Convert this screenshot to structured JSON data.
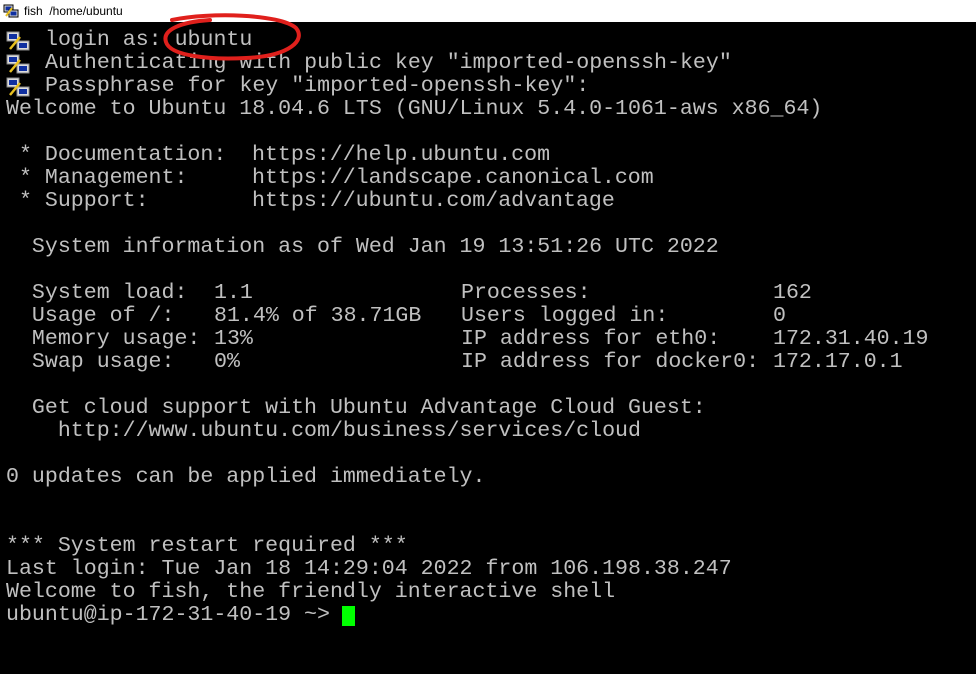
{
  "window": {
    "title": "fish  /home/ubuntu",
    "icon": "putty-icon"
  },
  "session": {
    "login_prefix": "login as: ",
    "username": "ubuntu",
    "auth_line": "Authenticating with public key \"imported-openssh-key\"",
    "passphrase_line": "Passphrase for key \"imported-openssh-key\":",
    "welcome": "Welcome to Ubuntu 18.04.6 LTS (GNU/Linux 5.4.0-1061-aws x86_64)"
  },
  "links": [
    {
      "label": " * Documentation:",
      "url": "https://help.ubuntu.com"
    },
    {
      "label": " * Management:",
      "url": "https://landscape.canonical.com"
    },
    {
      "label": " * Support:",
      "url": "https://ubuntu.com/advantage"
    }
  ],
  "sysinfo_header": "  System information as of Wed Jan 19 13:51:26 UTC 2022",
  "sysinfo": {
    "left": [
      {
        "label": "  System load:",
        "value": "1.1"
      },
      {
        "label": "  Usage of /:",
        "value": "81.4% of 38.71GB"
      },
      {
        "label": "  Memory usage:",
        "value": "13%"
      },
      {
        "label": "  Swap usage:",
        "value": "0%"
      }
    ],
    "right": [
      {
        "label": "Processes:",
        "value": "162"
      },
      {
        "label": "Users logged in:",
        "value": "0"
      },
      {
        "label": "IP address for eth0:",
        "value": "172.31.40.19"
      },
      {
        "label": "IP address for docker0:",
        "value": "172.17.0.1"
      }
    ]
  },
  "cloud": {
    "line1": "  Get cloud support with Ubuntu Advantage Cloud Guest:",
    "line2": "    http://www.ubuntu.com/business/services/cloud"
  },
  "updates_line": "0 updates can be applied immediately.",
  "restart_line": "*** System restart required ***",
  "last_login": "Last login: Tue Jan 18 14:29:04 2022 from 106.198.38.247",
  "fish_welcome": "Welcome to fish, the friendly interactive shell",
  "prompt": {
    "user_host": "ubuntu@ip-172-31-40-19",
    "path": " ~> "
  },
  "colors": {
    "background": "#000000",
    "text": "#c0c0c0",
    "cursor": "#00ff00",
    "annotation": "#e0201c"
  }
}
